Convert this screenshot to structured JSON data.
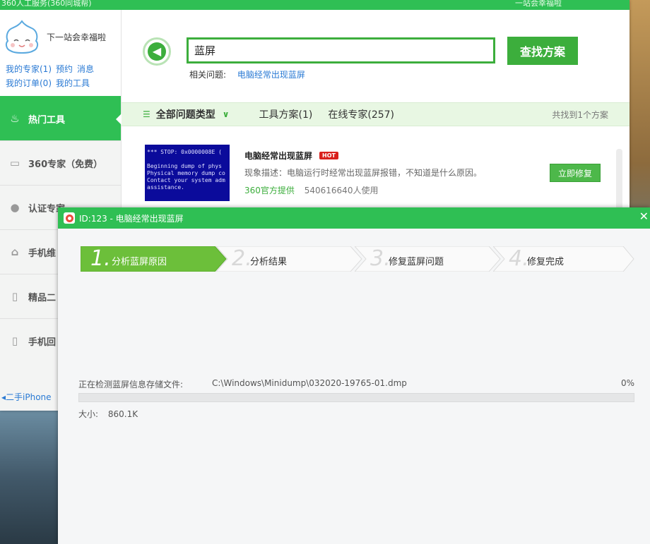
{
  "window": {
    "title": "360人工服务(360同城帮)",
    "title_right": "一站会幸福啦"
  },
  "profile": {
    "name": "下一站会幸福啦",
    "links": [
      "我的专家(1)",
      "预约",
      "消息",
      "我的订单(0)",
      "我的工具"
    ]
  },
  "sidebar": {
    "items": [
      {
        "label": "热门工具",
        "icon": "fire-icon",
        "active": true
      },
      {
        "label": "360专家（免费）",
        "icon": "monitor-icon",
        "active": false
      },
      {
        "label": "认证专家",
        "icon": "person-icon",
        "active": false
      },
      {
        "label": "手机维",
        "icon": "phone-repair-icon",
        "active": false
      },
      {
        "label": "精品二",
        "icon": "phone-icon",
        "active": false
      },
      {
        "label": "手机回",
        "icon": "phone-recycle-icon",
        "active": false
      }
    ],
    "footer": "二手iPhone"
  },
  "search": {
    "value": "蓝屏",
    "button": "查找方案",
    "related_label": "相关问题:",
    "related_link": "电脑经常出现蓝屏"
  },
  "filter": {
    "all_types": "全部问题类型",
    "tab_tools": "工具方案(1)",
    "tab_experts": "在线专家(257)",
    "count": "共找到1个方案"
  },
  "result": {
    "title": "电脑经常出现蓝屏",
    "badge": "HOT",
    "desc": "现象描述：电脑运行时经常出现蓝屏报错，不知道是什么原因。",
    "source": "360官方提供",
    "users": "540616640人使用",
    "fix_button": "立即修复",
    "thumb_text": "*** STOP: 0x0000008E (\n\nBeginning dump of phys\nPhysical memory dump co\nContact your system adm\nassistance."
  },
  "dialog": {
    "title": "ID:123 - 电脑经常出现蓝屏",
    "steps": [
      {
        "num": "1.",
        "label": "分析蓝屏原因",
        "active": true
      },
      {
        "num": "2.",
        "label": "分析结果",
        "active": false
      },
      {
        "num": "3.",
        "label": "修复蓝屏问题",
        "active": false
      },
      {
        "num": "4.",
        "label": "修复完成",
        "active": false
      }
    ],
    "status_label": "正在检测蓝屏信息存储文件:",
    "file_path": "C:\\Windows\\Minidump\\032020-19765-01.dmp",
    "progress_text": "0%",
    "progress": 0,
    "size_label": "大小:",
    "size_value": "860.1K"
  },
  "colors": {
    "brand_green": "#2fbf54",
    "button_green": "#3cae3c",
    "link_blue": "#2a7ad4",
    "hot_red": "#d9201c"
  }
}
